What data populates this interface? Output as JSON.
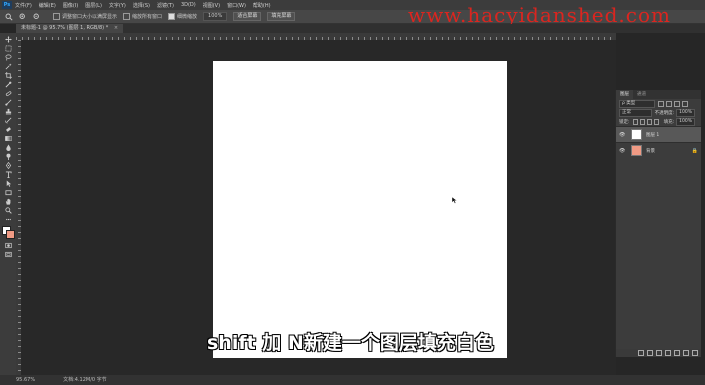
{
  "app": {
    "logo": "Ps",
    "menu": [
      "文件(F)",
      "编辑(E)",
      "图像(I)",
      "图层(L)",
      "文字(Y)",
      "选择(S)",
      "滤镜(T)",
      "3D(D)",
      "视图(V)",
      "窗口(W)",
      "帮助(H)"
    ]
  },
  "options": {
    "resize_windows": "调整窗口大小以满屏显示",
    "zoom_all": "缩放所有窗口",
    "scrubby_zoom": "细微缩放",
    "zoom_value": "100%",
    "fit_screen": "适合屏幕",
    "fill_screen": "填充屏幕"
  },
  "document": {
    "tab_title": "未标题-1 @ 95.7% (图层 1, RGB/8) *",
    "close_label": "×"
  },
  "subtitle": "shift 加 N新建一个图层填充白色",
  "watermark": "www.hacyidanshed.com",
  "layers_panel": {
    "tabs": [
      "图层",
      "通道"
    ],
    "filter_label": "ρ 类型",
    "blend_mode": "正常",
    "opacity_label": "不透明度:",
    "opacity_value": "100%",
    "lock_label": "锁定:",
    "fill_label": "填充:",
    "fill_value": "100%",
    "layers": [
      {
        "name": "图层 1",
        "selected": true,
        "thumb_color": "#ffffff",
        "locked": false
      },
      {
        "name": "背景",
        "selected": false,
        "thumb_color": "#f09a84",
        "locked": true
      }
    ]
  },
  "colors": {
    "foreground": "#ffffff",
    "background": "#f09a84",
    "watermark": "#e8231c"
  },
  "status": {
    "zoom": "95.67%",
    "doc_info": "文档:4.12M/0 字节"
  }
}
